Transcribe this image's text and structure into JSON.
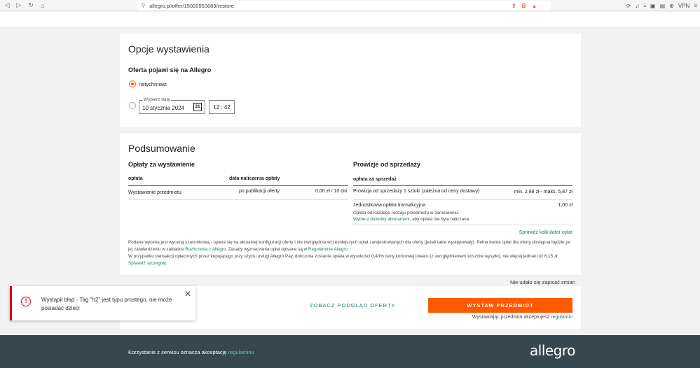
{
  "browser": {
    "url": "allegro.pl/offer/15020953689/restore",
    "vpn_label": "VPN",
    "brave_badge": "B"
  },
  "options": {
    "title": "Opcje wystawienia",
    "subtitle": "Oferta pojawi się na Allegro",
    "radio_now_label": "natychmiast",
    "date_legend": "Wybierz datę",
    "date_value": "10 stycznia 2024",
    "calendar_day": "31",
    "time_value": "12 : 42"
  },
  "summary": {
    "title": "Podsumowanie",
    "fees_title": "Opłaty za wystawienie",
    "col_fee": "opłata",
    "col_date": "data naliczenia opłaty",
    "row_name": "Wystawienie przedmiotu",
    "row_date_prefix": "po ",
    "row_date_link": "publikacji oferty",
    "row_amount": "0,00 zł / 10 dni",
    "commission_title": "Prowizje od sprzedaży",
    "col_commission": "opłata za sprzedaż",
    "commission_row": "Prowizja od sprzedaży 1 sztuki (zależna od ceny dostawy)",
    "commission_range": "min. 2,88 zł - maks. 5,87 zł",
    "transaction_fee": "Jednostkowa opłata transakcyjna",
    "transaction_fee_amount": "1,00 zł",
    "transaction_note": "Opłata od każdego rodzaju przedmiotu w zamówieniu.",
    "transaction_link": "Wybierz dowolny abonament",
    "transaction_link_suffix": ", aby opłata nie była naliczana.",
    "calculator_link": "Sprawdź kalkulator opłat",
    "note1_a": "Podana wycena jest wyceną szacunkową - opiera się na aktualnej konfiguracji oferty i nie uwzględnia wcześniejszych opłat zarejestrowanych dla oferty (jeżeli takie występowały). Pełna kwota opłat dla oferty dostępna będzie po jej zatwierdzeniu w zakładce ",
    "note1_link1": "Rozliczenia z Allegro",
    "note1_b": ". Zasady wyznaczania opłat opisane są w ",
    "note1_link2": "Regulaminie Allegro",
    "note1_c": ".",
    "note2_a": "W przypadku transakcji opłaconych przez kupującego przy użyciu usługi Allegro Pay, doliczona zostanie opłata w wysokości 0,43% ceny końcowej towaru (z uwzględnieniem kosztów wysyłki), nie więcej jednak niż 6,15 zł. ",
    "note2_link": "Sprawdź szczegóły",
    "note2_b": "."
  },
  "actions": {
    "save_status": "Nie udało się zapisać zmian",
    "preview_label": "ZOBACZ PODGLĄD OFERTY",
    "list_label": "WYSTAW PRZEDMIOT",
    "accept_prefix": "Wystawiając przedmiot akceptujesz ",
    "accept_link": "regulamin"
  },
  "toast": {
    "message": "Wystąpił błąd - Tag \"h2\" jest typu prostego, nie może posiadać dzieci"
  },
  "footer": {
    "text": "Korzystanie z serwisu oznacza akceptację ",
    "link": "regulaminu",
    "logo": "allegro"
  }
}
